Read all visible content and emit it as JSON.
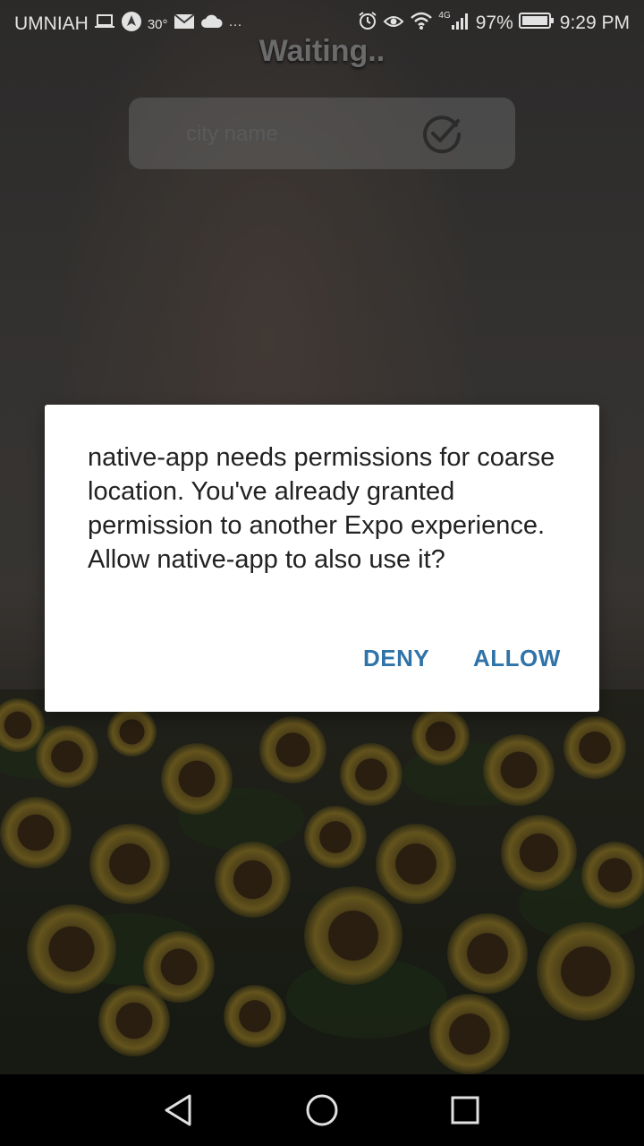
{
  "status_bar": {
    "carrier": "UMNIAH",
    "temperature": "30°",
    "more_indicator": "···",
    "network_type": "4G",
    "battery_percent": "97%",
    "time": "9:29 PM",
    "icons": [
      "laptop-icon",
      "navigation-icon",
      "mail-icon",
      "cloud-icon",
      "alarm-icon",
      "eye-icon",
      "wifi-icon",
      "signal-icon",
      "battery-icon"
    ]
  },
  "app": {
    "status_text": "Waiting..",
    "city_input": {
      "placeholder": "city name",
      "value": ""
    },
    "submit_icon": "check-circle-icon"
  },
  "dialog": {
    "message": "native-app needs permissions for coarse location. You've already granted permission to another Expo experience. Allow native-app to also use it?",
    "deny_label": "DENY",
    "allow_label": "ALLOW"
  },
  "nav_bar": {
    "buttons": [
      "back-icon",
      "home-icon",
      "recents-icon"
    ]
  },
  "colors": {
    "dialog_button": "#2f73a8",
    "dialog_background": "#ffffff",
    "dialog_text": "#222222"
  }
}
